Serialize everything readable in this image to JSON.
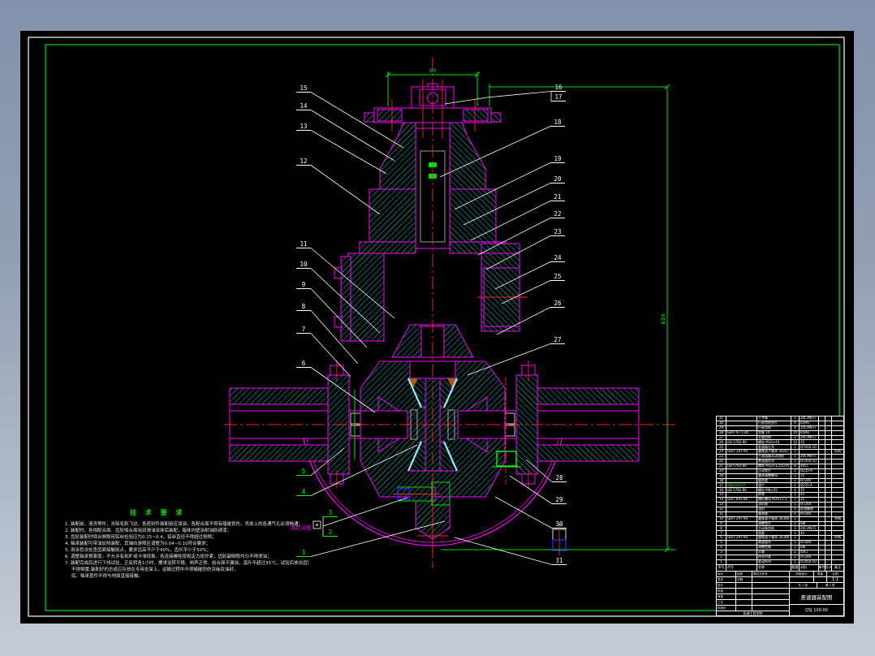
{
  "canvas": {
    "bg_outer_top": "#8291aa",
    "bg_outer_bottom": "#c6ccd6",
    "paper": "#000000",
    "border_color": "#ffffff",
    "frame_color": "#00e000"
  },
  "colors": {
    "outline": "#ff00ff",
    "hatch": "#00cccc",
    "centerline": "#ff2222",
    "dimension": "#00e000",
    "leader": "#ffffff",
    "hidden": "#ffff00"
  },
  "dimensions": {
    "top": "90",
    "overall": "620"
  },
  "annotations": {
    "note": "此处涂胶"
  },
  "tech_requirements": {
    "title": "技 术 要 求",
    "lines": [
      "1. 装配前，清洗零件，去除毛刺飞边，各密封件装配前应浸油，各配合面不得有磕碰划伤，壳体上的各通气孔必须畅通；",
      "2. 装配时，各相配合面、齿轮啮合面用润滑油涂抹后装配，箱体内壁涂耐油防锈漆；",
      "3. 齿轮装配时啮合侧隙用铅丝检验应为0.15~0.4，铅丝直径不得超过侧隙；",
      "4. 轴承装配可带油加热装配，其轴向游隙应调整为0.04~0.10符合要求；",
      "5. 用涂色法检查齿面接触斑点，要求齿高不少于40%，齿长不少于50%；",
      "6. 调整轴承预紧度，不允许有松旷或卡滞现象，各连接螺栓按规定力矩拧紧，齿轮副侧隙均匀不得渗油；",
      "7. 装配完成后进行下线试验，正反转各1小时，要求运转平稳、响声正常、结合面不漏油，温升不超过35℃，试验后放出齿轮油，",
      "   不得倒置;装配好的总成应存放在专用支架上，运输过程中不得磕碰划伤突缘及油封，",
      "   底、轴承盖件不得与地面直接接触。"
    ]
  },
  "callouts": [
    {
      "label": "1",
      "color": "green"
    },
    {
      "label": "2",
      "color": "green"
    },
    {
      "label": "3",
      "color": "green"
    },
    {
      "label": "4",
      "color": "green"
    },
    {
      "label": "5",
      "color": "green"
    },
    {
      "label": "6",
      "color": "white"
    },
    {
      "label": "7",
      "color": "white"
    },
    {
      "label": "8",
      "color": "white"
    },
    {
      "label": "9",
      "color": "white"
    },
    {
      "label": "10",
      "color": "white"
    },
    {
      "label": "11",
      "color": "white"
    },
    {
      "label": "12",
      "color": "white"
    },
    {
      "label": "13",
      "color": "white"
    },
    {
      "label": "14",
      "color": "white"
    },
    {
      "label": "15",
      "color": "white"
    },
    {
      "label": "16",
      "color": "white"
    },
    {
      "label": "17",
      "color": "white"
    },
    {
      "label": "18",
      "color": "white"
    },
    {
      "label": "19",
      "color": "white"
    },
    {
      "label": "20",
      "color": "white"
    },
    {
      "label": "21",
      "color": "white"
    },
    {
      "label": "22",
      "color": "white"
    },
    {
      "label": "23",
      "color": "white"
    },
    {
      "label": "24",
      "color": "white"
    },
    {
      "label": "25",
      "color": "white"
    },
    {
      "label": "26",
      "color": "white"
    },
    {
      "label": "27",
      "color": "white"
    },
    {
      "label": "28",
      "color": "white"
    },
    {
      "label": "29",
      "color": "white"
    },
    {
      "label": "30",
      "color": "white"
    },
    {
      "label": "31",
      "color": "white"
    }
  ],
  "parts_list": {
    "headers": [
      "序号",
      "代号",
      "名称",
      "数量",
      "材料",
      "单件",
      "总计",
      "备注"
    ],
    "highlight_row": "17",
    "rows": [
      [
        "31",
        "",
        "十字轴",
        "1",
        "20CrMnTi",
        "",
        "",
        ""
      ],
      [
        "30",
        "",
        "行星齿轮垫片",
        "4",
        "65Mn",
        "",
        "",
        ""
      ],
      [
        "29",
        "",
        "行星齿轮",
        "4",
        "20CrMnTi",
        "",
        "",
        ""
      ],
      [
        "28",
        "GB/T 97.1-85",
        "垫圈 10",
        "10",
        "65Mn",
        "",
        "",
        ""
      ],
      [
        "27",
        "",
        "半轴齿轮",
        "2",
        "20CrMnTi",
        "",
        "",
        ""
      ],
      [
        "26",
        "GB 5782-86",
        "螺栓 M10×40",
        "12",
        "35",
        "",
        "",
        ""
      ],
      [
        "25",
        "",
        "差速器左壳",
        "1",
        "QT450-10",
        "",
        "",
        ""
      ],
      [
        "24",
        "GB/T 297-94",
        "圆锥滚子轴承 30207",
        "2",
        "",
        "",
        "",
        "外购"
      ],
      [
        "23",
        "",
        "主减速器从动齿轮",
        "1",
        "20CrMnTi",
        "",
        "",
        ""
      ],
      [
        "22",
        "",
        "差速器右壳",
        "1",
        "QT450-10",
        "",
        "",
        ""
      ],
      [
        "21",
        "GB 5783-86",
        "螺栓 M12×1.25×45",
        "8",
        "40Cr",
        "",
        "",
        ""
      ],
      [
        "20",
        "",
        "止动垫片",
        "2",
        "Q235-A",
        "",
        "",
        ""
      ],
      [
        "19",
        "",
        "轴承调整螺母",
        "2",
        "35",
        "",
        "",
        ""
      ],
      [
        "18",
        "",
        "轴承盖",
        "2",
        "HT200",
        "",
        "",
        ""
      ],
      [
        "17",
        "QSJ 100-17",
        "锁片",
        "2",
        "Q235-A",
        "",
        "",
        ""
      ],
      [
        "16",
        "GB 5782-86",
        "螺栓 M8×25",
        "4",
        "35",
        "",
        "",
        ""
      ],
      [
        "15",
        "",
        "突缘",
        "1",
        "45",
        "",
        "",
        ""
      ],
      [
        "14",
        "GB/T 892-86",
        "槽形螺母 M24×1.5",
        "1",
        "35",
        "",
        "",
        ""
      ],
      [
        "13",
        "",
        "油封座",
        "1",
        "HT200",
        "",
        "",
        ""
      ],
      [
        "12",
        "",
        "油封",
        "1",
        "耐油橡胶",
        "",
        "",
        ""
      ],
      [
        "11",
        "",
        "轴承座",
        "1",
        "HT200",
        "",
        "",
        ""
      ],
      [
        "10",
        "GB/T 297-94",
        "圆锥滚子轴承 30308",
        "1",
        "",
        "",
        "",
        "外购"
      ],
      [
        "9",
        "",
        "调整垫片",
        "2",
        "08F",
        "",
        "",
        ""
      ],
      [
        "8",
        "",
        "主动锥齿轮",
        "1",
        "20CrMnTi",
        "",
        "",
        ""
      ],
      [
        "7",
        "",
        "隔套",
        "1",
        "45",
        "",
        "",
        ""
      ],
      [
        "6",
        "GB/T 297-94",
        "圆锥滚子轴承 30306",
        "1",
        "",
        "",
        "",
        "外购"
      ],
      [
        "5",
        "",
        "减速器壳",
        "1",
        "HT200",
        "",
        "",
        ""
      ],
      [
        "4",
        "",
        "调整垫圈",
        "2",
        "08F",
        "",
        "",
        ""
      ],
      [
        "3",
        "",
        "半轴",
        "2",
        "40Cr",
        "",
        "",
        ""
      ],
      [
        "2",
        "",
        "桥壳衬套",
        "2",
        "HT200",
        "",
        "",
        ""
      ],
      [
        "1",
        "",
        "驱动桥壳",
        "1",
        "QT450-10",
        "",
        "",
        ""
      ]
    ]
  },
  "title_block": {
    "rows_left": [
      [
        "标记",
        "处数",
        "更改文件号"
      ],
      [
        "签字",
        "日期",
        ""
      ],
      [
        "设计",
        "",
        ""
      ],
      [
        "校核",
        "",
        ""
      ],
      [
        "审核",
        "",
        ""
      ],
      [
        "工艺",
        "",
        ""
      ],
      [
        "标准化",
        "",
        ""
      ]
    ],
    "school": "机械工程学院",
    "stage_label": "阶段标记",
    "mass_label": "质量",
    "scale_label": "比例",
    "scale_value": "1:1",
    "sheets": "共 1 张",
    "sheet_no": "第 1 张",
    "title": "差速器装配图",
    "drawing_no": "QSJ 100-00"
  }
}
